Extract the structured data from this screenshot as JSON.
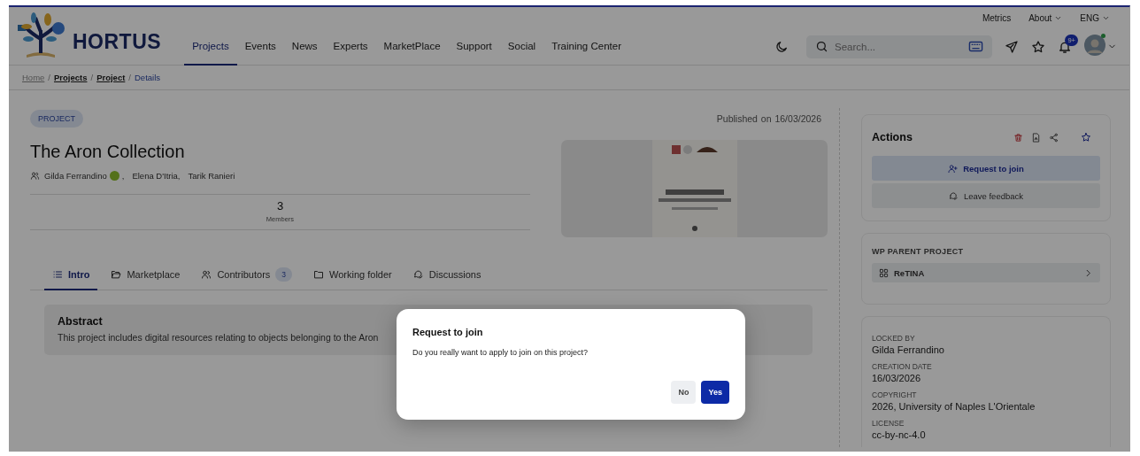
{
  "header": {
    "utility_links": [
      {
        "label": "Metrics",
        "dropdown": false
      },
      {
        "label": "About",
        "dropdown": true
      },
      {
        "label": "ENG",
        "dropdown": true
      }
    ],
    "logo": {
      "text": "HORTUS"
    },
    "nav": [
      {
        "label": "Projects",
        "selected": true
      },
      {
        "label": "Events",
        "selected": false
      },
      {
        "label": "News",
        "selected": false
      },
      {
        "label": "Experts",
        "selected": false
      },
      {
        "label": "MarketPlace",
        "selected": false
      },
      {
        "label": "Support",
        "selected": false
      },
      {
        "label": "Social",
        "selected": false
      },
      {
        "label": "Training Center",
        "selected": false
      }
    ],
    "search": {
      "placeholder": "Search..."
    },
    "notifications_badge": "9+"
  },
  "breadcrumb": {
    "separator": "/",
    "items": [
      {
        "label": "Home",
        "kind": "muted"
      },
      {
        "label": "Projects",
        "kind": "link"
      },
      {
        "label": "Project",
        "kind": "link"
      },
      {
        "label": "Details",
        "kind": "current"
      }
    ]
  },
  "project": {
    "tag": "PROJECT",
    "published_label": "Published on",
    "published_date": "16/03/2026",
    "title": "The Aron Collection",
    "authors": [
      {
        "name": "Gilda Ferrandino",
        "orcid": true,
        "suffix": ","
      },
      {
        "name": "Elena D'Itria,",
        "orcid": false
      },
      {
        "name": "Tarik Ranieri",
        "orcid": false
      }
    ],
    "stats": [
      {
        "value": "3",
        "label": "Members"
      }
    ]
  },
  "tabs": [
    {
      "label": "Intro",
      "selected": true
    },
    {
      "label": "Marketplace",
      "selected": false
    },
    {
      "label": "Contributors",
      "selected": false,
      "count": "3"
    },
    {
      "label": "Working folder",
      "selected": false
    },
    {
      "label": "Discussions",
      "selected": false
    }
  ],
  "abstract": {
    "title": "Abstract",
    "text": "This project includes digital resources relating to objects belonging to the Aron"
  },
  "sidebar": {
    "actions": {
      "title": "Actions",
      "buttons": [
        {
          "label": "Request to join",
          "kind": "primary"
        },
        {
          "label": "Leave feedback",
          "kind": "secondary"
        }
      ]
    },
    "parent": {
      "title": "WP PARENT PROJECT",
      "item": "ReTINA"
    },
    "info": [
      {
        "label": "LOCKED BY",
        "value": "Gilda Ferrandino"
      },
      {
        "label": "CREATION DATE",
        "value": "16/03/2026"
      },
      {
        "label": "COPYRIGHT",
        "value": "2026, University of Naples L'Orientale"
      },
      {
        "label": "LICENSE",
        "value": "cc-by-nc-4.0"
      }
    ]
  },
  "modal": {
    "title": "Request to join",
    "message": "Do you really want to apply to join on this project?",
    "buttons": [
      {
        "label": "No",
        "kind": "secondary"
      },
      {
        "label": "Yes",
        "kind": "primary"
      }
    ]
  }
}
